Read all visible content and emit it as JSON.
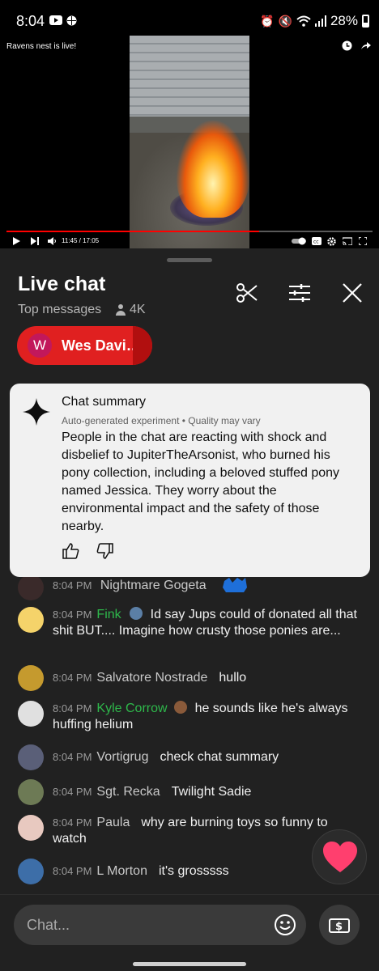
{
  "status_bar": {
    "time": "8:04",
    "battery": "28%"
  },
  "video": {
    "title": "Ravens nest is live!",
    "time_display": "11:45 / 17:05",
    "progress": 0.69
  },
  "chat_header": {
    "title": "Live chat",
    "filter_label": "Top messages",
    "viewer_count": "4K"
  },
  "pinned": {
    "initial": "W",
    "name": "Wes Davi…"
  },
  "summary": {
    "title": "Chat summary",
    "subtitle": "Auto-generated experiment • Quality may vary",
    "body": "People in the chat are reacting with shock and disbelief to JupiterTheArsonist, who burned his pony collection, including a beloved stuffed pony named Jessica. They worry about the environmental impact and the safety of those nearby."
  },
  "messages": [
    {
      "time": "8:04 PM",
      "author": "Nightmare Gogeta",
      "text": "",
      "author_color": "#c9c9c9",
      "avatar_color": "#3a2a2a"
    },
    {
      "time": "8:04 PM",
      "author": "Fink",
      "text": "Id say Jups could of donated all that shit BUT.... Imagine how crusty those ponies are...",
      "author_color": "#2eb84b",
      "avatar_color": "#f5d36a"
    },
    {
      "time": "8:04 PM",
      "author": "Salvatore Nostrade",
      "text": "hullo",
      "author_color": "#c9c9c9",
      "avatar_color": "#c59a2e"
    },
    {
      "time": "8:04 PM",
      "author": "Kyle Corrow",
      "text": "he sounds like he's always huffing helium",
      "author_color": "#2eb84b",
      "avatar_color": "#e0e0e0"
    },
    {
      "time": "8:04 PM",
      "author": "Vortigrug",
      "text": "check chat summary",
      "author_color": "#c9c9c9",
      "avatar_color": "#5a5f78"
    },
    {
      "time": "8:04 PM",
      "author": "Sgt. Recka",
      "text": "Twilight Sadie",
      "author_color": "#c9c9c9",
      "avatar_color": "#6d7a55"
    },
    {
      "time": "8:04 PM",
      "author": "Paula",
      "text": "why are burning toys so funny to watch",
      "author_color": "#c9c9c9",
      "avatar_color": "#e8c9c0"
    },
    {
      "time": "8:04 PM",
      "author": "L Morton",
      "text": "it's grosssss",
      "author_color": "#c9c9c9",
      "avatar_color": "#3d6ea8"
    }
  ],
  "input": {
    "placeholder": "Chat..."
  },
  "icons": {
    "clip": "scissors-icon",
    "settings": "sliders-icon",
    "close": "close-icon",
    "heart": "heart-icon",
    "emoji": "emoji-icon",
    "super_chat": "dollar-icon"
  },
  "colors": {
    "accent": "#e02020",
    "progress": "#ff0000",
    "heart": "#ff3f6e"
  }
}
